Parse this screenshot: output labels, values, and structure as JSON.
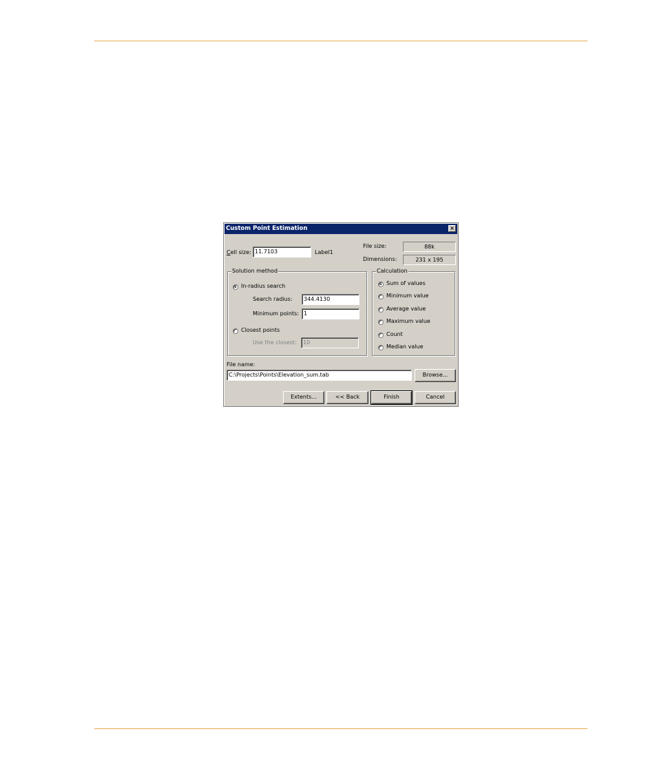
{
  "dialog": {
    "title": "Custom Point Estimation",
    "close_symbol": "×"
  },
  "cell_size": {
    "label": "Cell size:",
    "value": "11.7103",
    "unit_label": "Label1"
  },
  "file_size": {
    "label": "File size:",
    "value": "88k"
  },
  "dimensions": {
    "label": "Dimensions:",
    "value": "231 x 195"
  },
  "solution_method": {
    "legend": "Solution method",
    "in_radius": {
      "label": "In-radius search",
      "selected": true
    },
    "search_radius": {
      "label": "Search radius:",
      "value": "344.4130"
    },
    "minimum_points": {
      "label": "Minimum points:",
      "value": "1"
    },
    "closest_points": {
      "label": "Closest points",
      "selected": false
    },
    "use_closest": {
      "label": "Use the closest:",
      "value": "10"
    }
  },
  "calculation": {
    "legend": "Calculation",
    "options": [
      {
        "label": "Sum of values",
        "selected": true
      },
      {
        "label": "Minimum value",
        "selected": false
      },
      {
        "label": "Average value",
        "selected": false
      },
      {
        "label": "Maximum value",
        "selected": false
      },
      {
        "label": "Count",
        "selected": false
      },
      {
        "label": "Median value",
        "selected": false
      }
    ]
  },
  "file_name": {
    "label": "File name:",
    "value": "C:\\Projects\\Points\\Elevation_sum.tab"
  },
  "buttons": {
    "browse": "Browse...",
    "extents": "Extents...",
    "back": "<< Back",
    "finish": "Finish",
    "cancel": "Cancel"
  },
  "colors": {
    "titlebar": "#0a246a",
    "dialog_face": "#d4d0c8",
    "page_rule": "#e8a94a"
  }
}
